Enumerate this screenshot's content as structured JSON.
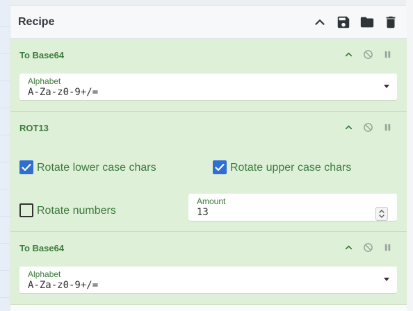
{
  "recipe": {
    "title": "Recipe",
    "controls": [
      "chevron-up-icon",
      "save-icon",
      "folder-icon",
      "trash-icon"
    ]
  },
  "operations": [
    {
      "title": "To Base64",
      "alphabet_label": "Alphabet",
      "alphabet_value": "A-Za-z0-9+/="
    },
    {
      "title": "ROT13",
      "rotate_lower_label": "Rotate lower case chars",
      "rotate_lower_checked": true,
      "rotate_upper_label": "Rotate upper case chars",
      "rotate_upper_checked": true,
      "rotate_numbers_label": "Rotate numbers",
      "rotate_numbers_checked": false,
      "amount_label": "Amount",
      "amount_value": "13"
    },
    {
      "title": "To Base64",
      "alphabet_label": "Alphabet",
      "alphabet_value": "A-Za-z0-9+/="
    }
  ],
  "colors": {
    "operation_bg": "#dff0d8",
    "operation_text": "#3c7a3c",
    "checkbox_checked": "#2f6fd0"
  }
}
